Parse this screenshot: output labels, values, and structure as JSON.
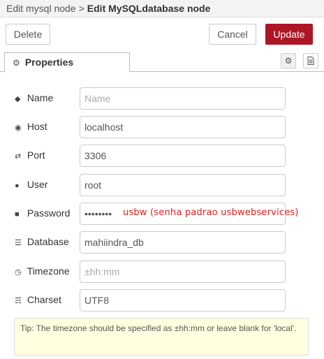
{
  "breadcrumb": {
    "parent": "Edit mysql node",
    "separator": ">",
    "current": "Edit MySQLdatabase node"
  },
  "toolbar": {
    "delete_label": "Delete",
    "cancel_label": "Cancel",
    "update_label": "Update"
  },
  "tabs": {
    "properties_label": "Properties"
  },
  "fields": {
    "name": {
      "label": "Name",
      "value": "",
      "placeholder": "Name"
    },
    "host": {
      "label": "Host",
      "value": "localhost",
      "placeholder": ""
    },
    "port": {
      "label": "Port",
      "value": "3306",
      "placeholder": ""
    },
    "user": {
      "label": "User",
      "value": "root",
      "placeholder": ""
    },
    "password": {
      "label": "Password",
      "value": "••••••••",
      "placeholder": ""
    },
    "database": {
      "label": "Database",
      "value": "mahiindra_db",
      "placeholder": ""
    },
    "timezone": {
      "label": "Timezone",
      "value": "",
      "placeholder": "±hh:mm"
    },
    "charset": {
      "label": "Charset",
      "value": "UTF8",
      "placeholder": ""
    }
  },
  "annotation": "usbw (senha padrao usbwebservices)",
  "tip": "Tip: The timezone should be specified as ±hh:mm or leave blank for 'local'.",
  "colors": {
    "update_button": "#ad1625",
    "annotation_text": "#e0201d",
    "tip_background": "#ffffe0"
  }
}
